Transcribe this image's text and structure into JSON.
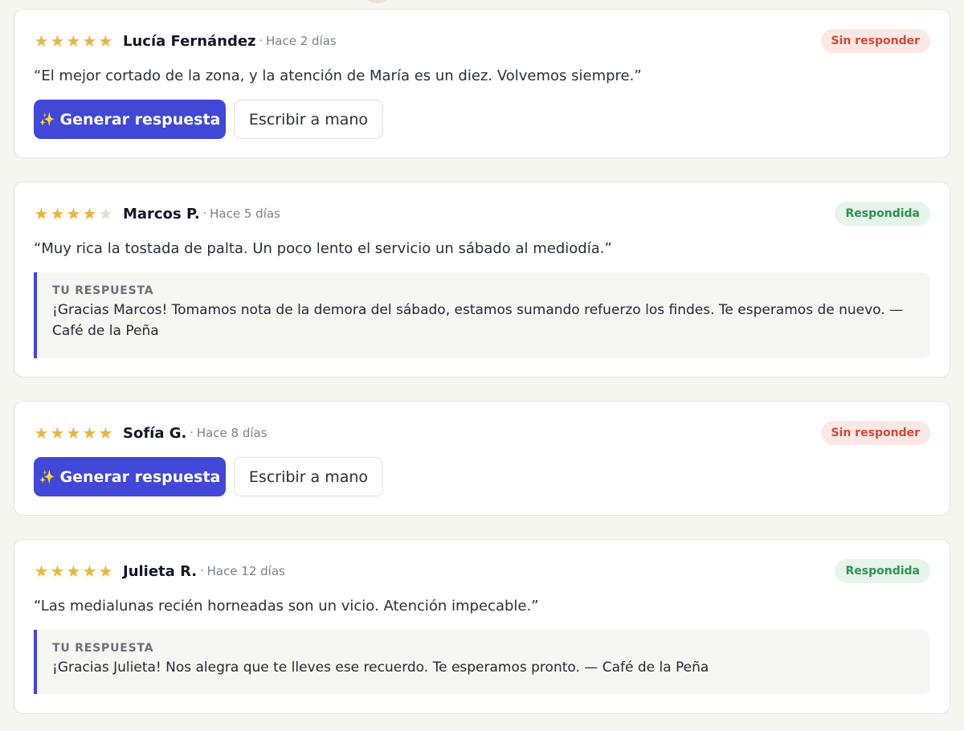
{
  "reviews": [
    {
      "rating": 5,
      "author": "Lucía Fernández",
      "separator": "·",
      "when": "Hace 2 días",
      "status": "Sin responder",
      "text": "“El mejor cortado de la zona, y la atención de María es un diez. Volvemos siempre.”",
      "actions": {
        "generate": "Generar respuesta",
        "generate_icon": "✨",
        "manual": "Escribir a mano"
      }
    },
    {
      "rating": 4,
      "author": "Marcos P.",
      "separator": "·",
      "when": "Hace 5 días",
      "status": "Respondida",
      "text": "“Muy rica la tostada de palta. Un poco lento el servicio un sábado al mediodía.”",
      "reply": {
        "label": "TU RESPUESTA",
        "text": "¡Gracias Marcos! Tomamos nota de la demora del sábado, estamos sumando refuerzo los findes. Te esperamos de nuevo. — Café de la Peña"
      }
    },
    {
      "rating": 5,
      "author": "Sofía G.",
      "separator": "·",
      "when": "Hace 8 días",
      "status": "Sin responder",
      "actions": {
        "generate": "Generar respuesta",
        "generate_icon": "✨",
        "manual": "Escribir a mano"
      }
    },
    {
      "rating": 5,
      "author": "Julieta R.",
      "separator": "·",
      "when": "Hace 12 días",
      "status": "Respondida",
      "text": "“Las medialunas recién horneadas son un vicio. Atención impecable.”",
      "reply": {
        "label": "TU RESPUESTA",
        "text": "¡Gracias Julieta! Nos alegra que te lleves ese recuerdo. Te esperamos pronto. — Café de la Peña"
      }
    }
  ],
  "colors": {
    "accent": "#4147d6",
    "star": "#e9b53c",
    "pending_badge": "#cf4a3a",
    "done_badge": "#2f9152",
    "background": "#f6f6f1"
  }
}
